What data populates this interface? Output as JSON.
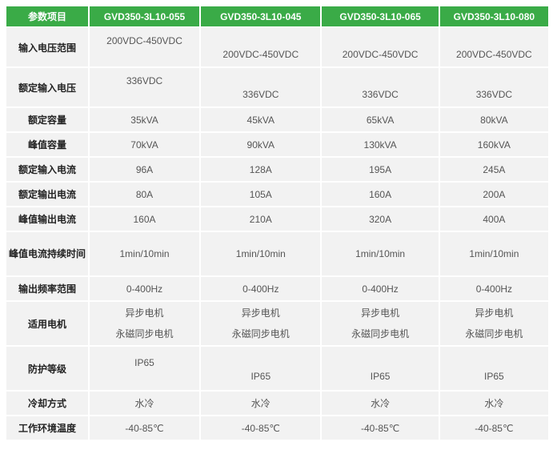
{
  "header": [
    "参数项目",
    "GVD350-3L10-055",
    "GVD350-3L10-045",
    "GVD350-3L10-065",
    "GVD350-3L10-080"
  ],
  "rows": [
    {
      "label": "输入电压范围",
      "values": [
        "200VDC-450VDC",
        "200VDC-450VDC",
        "200VDC-450VDC",
        "200VDC-450VDC"
      ]
    },
    {
      "label": "额定输入电压",
      "values": [
        "336VDC",
        "336VDC",
        "336VDC",
        "336VDC"
      ]
    },
    {
      "label": "额定容量",
      "values": [
        "35kVA",
        "45kVA",
        "65kVA",
        "80kVA"
      ]
    },
    {
      "label": "峰值容量",
      "values": [
        "70kVA",
        "90kVA",
        "130kVA",
        "160kVA"
      ]
    },
    {
      "label": "额定输入电流",
      "values": [
        "96A",
        "128A",
        "195A",
        "245A"
      ]
    },
    {
      "label": "额定输出电流",
      "values": [
        "80A",
        "105A",
        "160A",
        "200A"
      ]
    },
    {
      "label": "峰值输出电流",
      "values": [
        "160A",
        "210A",
        "320A",
        "400A"
      ]
    },
    {
      "label": "峰值电流持续时间",
      "values": [
        "1min/10min",
        "1min/10min",
        "1min/10min",
        "1min/10min"
      ]
    },
    {
      "label": "输出频率范围",
      "values": [
        "0-400Hz",
        "0-400Hz",
        "0-400Hz",
        "0-400Hz"
      ]
    },
    {
      "label": "适用电机",
      "values": [
        [
          "异步电机",
          "永磁同步电机"
        ],
        [
          "异步电机",
          "永磁同步电机"
        ],
        [
          "异步电机",
          "永磁同步电机"
        ],
        [
          "异步电机",
          "永磁同步电机"
        ]
      ]
    },
    {
      "label": "防护等级",
      "values": [
        "IP65",
        "IP65",
        "IP65",
        "IP65"
      ]
    },
    {
      "label": "冷却方式",
      "values": [
        "水冷",
        "水冷",
        "水冷",
        "水冷"
      ]
    },
    {
      "label": "工作环境温度",
      "values": [
        "-40-85℃",
        "-40-85℃",
        "-40-85℃",
        "-40-85℃"
      ]
    }
  ]
}
